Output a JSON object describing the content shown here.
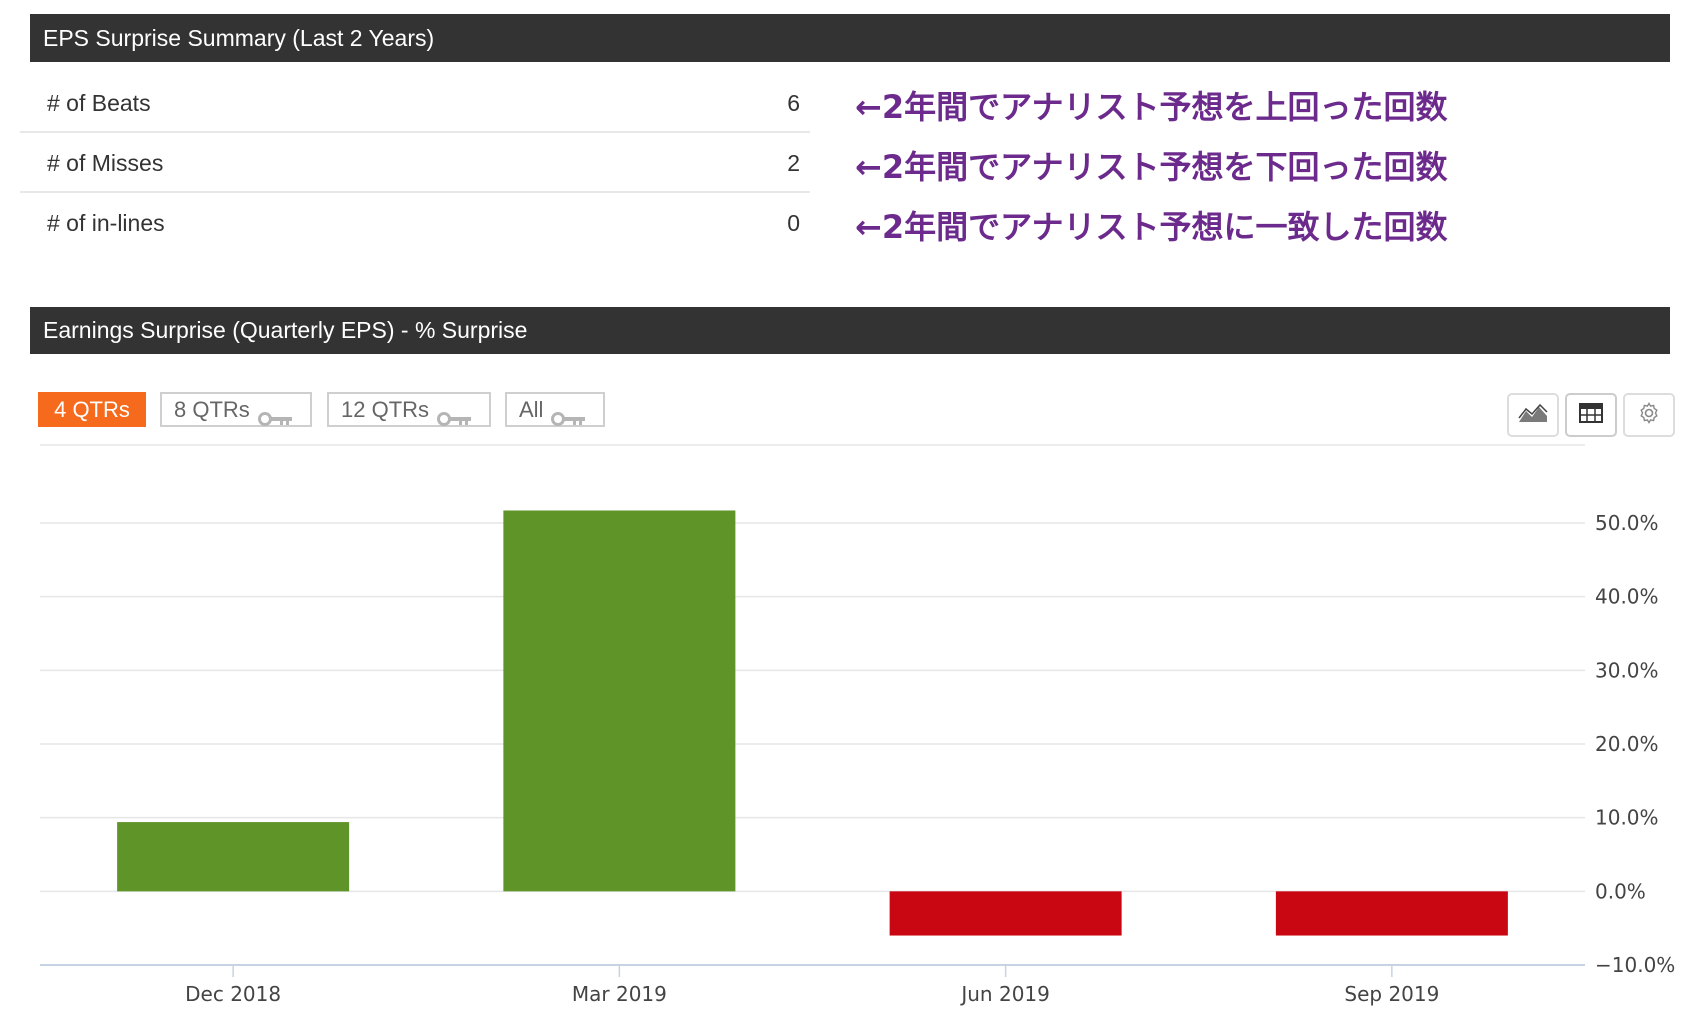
{
  "summary": {
    "title": "EPS Surprise Summary (Last 2 Years)",
    "rows": [
      {
        "label": "# of Beats",
        "value": "6",
        "note": "←2年間でアナリスト予想を上回った回数"
      },
      {
        "label": "# of Misses",
        "value": "2",
        "note": "←2年間でアナリスト予想を下回った回数"
      },
      {
        "label": "# of in-lines",
        "value": "0",
        "note": "←2年間でアナリスト予想に一致した回数"
      }
    ]
  },
  "chart_panel": {
    "title": "Earnings Surprise (Quarterly EPS) - % Surprise",
    "range_buttons": [
      {
        "label": "4 QTRs",
        "active": true,
        "locked": false
      },
      {
        "label": "8 QTRs",
        "active": false,
        "locked": true
      },
      {
        "label": "12 QTRs",
        "active": false,
        "locked": true
      },
      {
        "label": "All",
        "active": false,
        "locked": true
      }
    ],
    "tools": [
      "area-chart-icon",
      "table-icon",
      "gear-icon"
    ]
  },
  "chart_data": {
    "type": "bar",
    "categories": [
      "Dec 2018",
      "Mar 2019",
      "Jun 2019",
      "Sep 2019"
    ],
    "values": [
      9.4,
      51.7,
      -6.0,
      -6.0
    ],
    "ylim": [
      -10,
      50
    ],
    "yticks": [
      "50.0%",
      "40.0%",
      "30.0%",
      "20.0%",
      "10.0%",
      "0.0%",
      "−10.0%"
    ],
    "ytick_values": [
      50,
      40,
      30,
      20,
      10,
      0,
      -10
    ],
    "y_axis_side": "right",
    "grid": true,
    "colors": {
      "positive": "#5f9428",
      "negative": "#c90712",
      "grid": "#e6e6e6",
      "axis": "#c6d3e3"
    }
  }
}
